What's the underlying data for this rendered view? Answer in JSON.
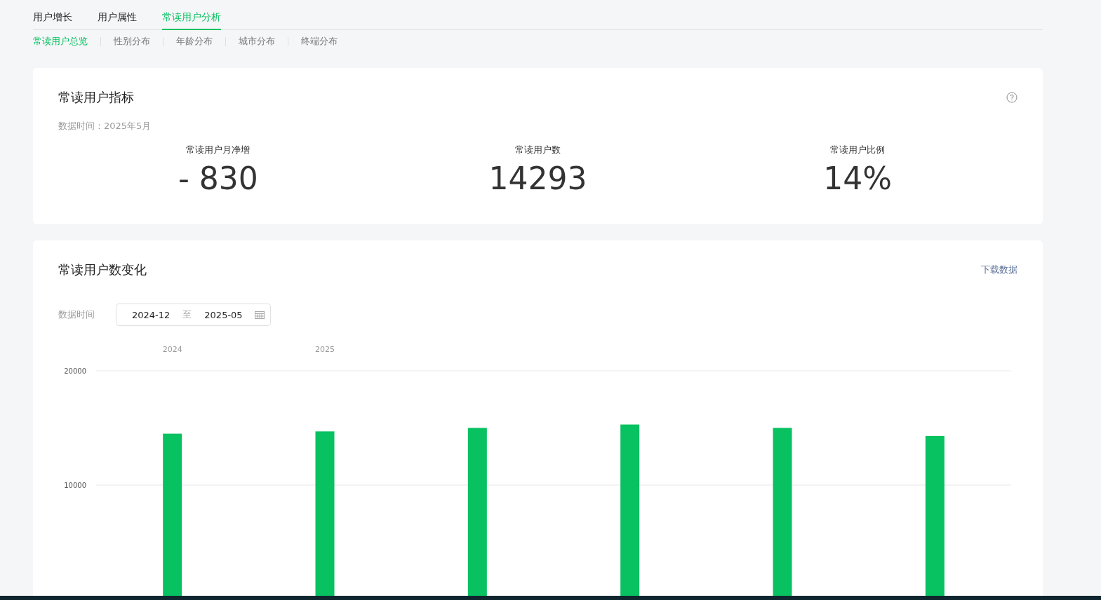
{
  "tabs": [
    {
      "label": "用户增长",
      "selected": false
    },
    {
      "label": "用户属性",
      "selected": false
    },
    {
      "label": "常读用户分析",
      "selected": true
    }
  ],
  "subtabs": [
    {
      "label": "常读用户总览",
      "selected": true
    },
    {
      "label": "性别分布",
      "selected": false
    },
    {
      "label": "年龄分布",
      "selected": false
    },
    {
      "label": "城市分布",
      "selected": false
    },
    {
      "label": "终端分布",
      "selected": false
    }
  ],
  "metrics_card": {
    "title": "常读用户指标",
    "data_time": "数据时间：2025年5月",
    "metrics": [
      {
        "label": "常读用户月净增",
        "value": "- 830"
      },
      {
        "label": "常读用户数",
        "value": "14293"
      },
      {
        "label": "常读用户比例",
        "value": "14%"
      }
    ]
  },
  "trend_card": {
    "title": "常读用户数变化",
    "download": "下载数据",
    "filter_label": "数据时间",
    "start": "2024-12",
    "separator": "至",
    "end": "2025-05",
    "chart_data": {
      "type": "bar",
      "categories": [
        "2024",
        "2025",
        null,
        null,
        null,
        null
      ],
      "yticks": [
        10000,
        20000
      ],
      "ylim": [
        0,
        20000
      ],
      "series": [
        {
          "color": "#08c160",
          "values": [
            14500,
            14700,
            15000,
            15300,
            15000,
            14300
          ]
        }
      ]
    }
  }
}
